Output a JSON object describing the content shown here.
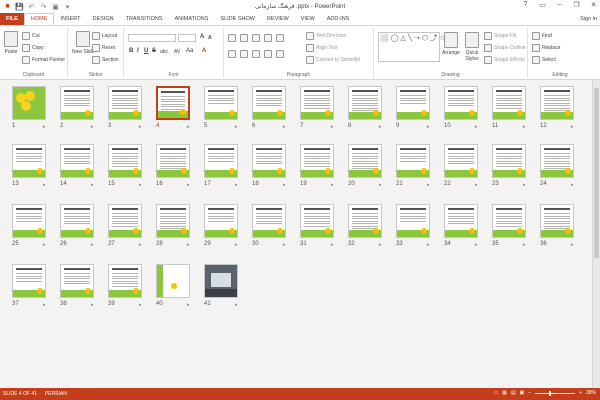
{
  "window": {
    "title": "فرهنگ سازمانی .pptx - PowerPoint",
    "signin": "Sign in"
  },
  "qat": {
    "save": "💾",
    "undo": "↶",
    "redo": "↷",
    "start": "▣",
    "customize": "▾"
  },
  "window_controls": {
    "help": "?",
    "ribbon_opts": "▭",
    "minimize": "–",
    "restore": "❐",
    "close": "✕"
  },
  "tabs": [
    {
      "label": "FILE"
    },
    {
      "label": "HOME"
    },
    {
      "label": "INSERT"
    },
    {
      "label": "DESIGN"
    },
    {
      "label": "TRANSITIONS"
    },
    {
      "label": "ANIMATIONS"
    },
    {
      "label": "SLIDE SHOW"
    },
    {
      "label": "REVIEW"
    },
    {
      "label": "VIEW"
    },
    {
      "label": "ADD-INS"
    }
  ],
  "ribbon": {
    "clipboard": {
      "label": "Clipboard",
      "paste": "Paste",
      "cut": "Cut",
      "copy": "Copy",
      "format_painter": "Format Painter"
    },
    "slides": {
      "label": "Slides",
      "new_slide": "New Slide",
      "layout": "Layout",
      "reset": "Reset",
      "section": "Section"
    },
    "font": {
      "label": "Font",
      "bold": "B",
      "italic": "I",
      "underline": "U",
      "strike": "S",
      "shadow": "abc",
      "spacing": "AV",
      "case": "Aa",
      "color": "A"
    },
    "paragraph": {
      "label": "Paragraph",
      "text_direction": "Text Direction",
      "align_text": "Align Text",
      "convert_smartart": "Convert to SmartArt"
    },
    "drawing": {
      "label": "Drawing",
      "arrange": "Arrange",
      "quick_styles": "Quick Styles",
      "shape_fill": "Shape Fill",
      "shape_outline": "Shape Outline",
      "shape_effects": "Shape Effects",
      "shapes": "⬜◯△╲➝⬡⤴☆{}"
    },
    "editing": {
      "label": "Editing",
      "find": "Find",
      "replace": "Replace",
      "select": "Select"
    }
  },
  "slides": [
    {
      "num": "1",
      "kind": "title"
    },
    {
      "num": "2",
      "kind": "text"
    },
    {
      "num": "3",
      "kind": "text"
    },
    {
      "num": "4",
      "kind": "text",
      "selected": true
    },
    {
      "num": "5",
      "kind": "text"
    },
    {
      "num": "6",
      "kind": "text"
    },
    {
      "num": "7",
      "kind": "text"
    },
    {
      "num": "8",
      "kind": "text"
    },
    {
      "num": "9",
      "kind": "text"
    },
    {
      "num": "10",
      "kind": "text"
    },
    {
      "num": "11",
      "kind": "text"
    },
    {
      "num": "12",
      "kind": "text"
    },
    {
      "num": "13",
      "kind": "text"
    },
    {
      "num": "14",
      "kind": "text"
    },
    {
      "num": "15",
      "kind": "text"
    },
    {
      "num": "16",
      "kind": "text"
    },
    {
      "num": "17",
      "kind": "text"
    },
    {
      "num": "18",
      "kind": "text"
    },
    {
      "num": "19",
      "kind": "text"
    },
    {
      "num": "20",
      "kind": "text"
    },
    {
      "num": "21",
      "kind": "text"
    },
    {
      "num": "22",
      "kind": "text"
    },
    {
      "num": "23",
      "kind": "text"
    },
    {
      "num": "24",
      "kind": "text"
    },
    {
      "num": "25",
      "kind": "text"
    },
    {
      "num": "26",
      "kind": "text"
    },
    {
      "num": "27",
      "kind": "text"
    },
    {
      "num": "28",
      "kind": "text"
    },
    {
      "num": "29",
      "kind": "text"
    },
    {
      "num": "30",
      "kind": "text"
    },
    {
      "num": "31",
      "kind": "text"
    },
    {
      "num": "32",
      "kind": "text"
    },
    {
      "num": "33",
      "kind": "text"
    },
    {
      "num": "34",
      "kind": "text"
    },
    {
      "num": "35",
      "kind": "text"
    },
    {
      "num": "36",
      "kind": "text"
    },
    {
      "num": "37",
      "kind": "text"
    },
    {
      "num": "38",
      "kind": "text"
    },
    {
      "num": "39",
      "kind": "text"
    },
    {
      "num": "40",
      "kind": "strip"
    },
    {
      "num": "41",
      "kind": "photo"
    }
  ],
  "status": {
    "slide": "SLIDE 4 OF 41",
    "language": "PERSIAN",
    "zoom": "38%"
  },
  "colors": {
    "accent": "#c43e1c",
    "slide_green": "#8cc63f",
    "sun": "#f4c300"
  }
}
